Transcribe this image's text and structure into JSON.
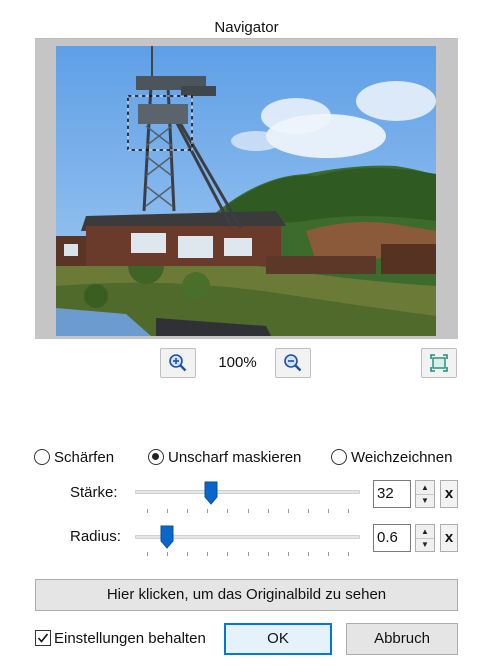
{
  "navigator": {
    "title": "Navigator",
    "zoom_level": "100%",
    "image_alt": "Förderturm am Hang"
  },
  "modes": {
    "sharpen": "Schärfen",
    "unsharp_mask": "Unscharf maskieren",
    "soften": "Weichzeichnen",
    "selected": "unsharp_mask"
  },
  "strength": {
    "label": "Stärke:",
    "value": "32",
    "level": 0.32
  },
  "radius": {
    "label": "Radius:",
    "value": "0.6",
    "level": 0.1
  },
  "clear_symbol": "x",
  "buttons": {
    "show_original": "Hier klicken, um das Originalbild zu sehen",
    "keep_settings": "Einstellungen behalten",
    "keep_settings_checked": true,
    "ok": "OK",
    "cancel": "Abbruch"
  },
  "icons": {
    "zoom_in": "zoom-in-icon",
    "zoom_out": "zoom-out-icon",
    "fit": "fit-to-window-icon"
  },
  "colors": {
    "accent": "#0078d7",
    "sky": "#7fb3e8"
  }
}
